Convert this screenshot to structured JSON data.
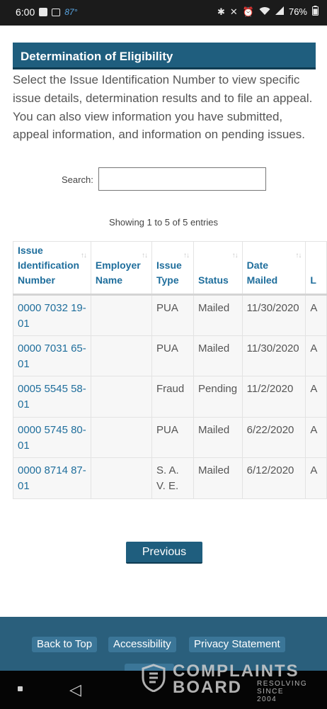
{
  "status_bar": {
    "time": "6:00",
    "temperature": "87°",
    "battery": "76%",
    "icons": [
      "notification-square-icon",
      "gallery-icon",
      "bluetooth-icon",
      "mute-icon",
      "alarm-icon",
      "wifi-icon",
      "signal-icon",
      "battery-icon"
    ]
  },
  "page": {
    "title": "Determination of Eligibility",
    "intro": "Select the Issue Identification Number to view specific issue details, determination results and to file an appeal. You can also view information you have submitted, appeal information, and information on pending issues."
  },
  "search": {
    "label": "Search:",
    "value": "",
    "placeholder": ""
  },
  "table_info": "Showing 1 to 5 of 5 entries",
  "table": {
    "columns": [
      {
        "label": "Issue Identification Number"
      },
      {
        "label": "Employer Name"
      },
      {
        "label": "Issue Type"
      },
      {
        "label": "Status"
      },
      {
        "label": "Date Mailed"
      },
      {
        "label": "L"
      }
    ],
    "rows": [
      {
        "issue_id": "0000 7032 19-01",
        "employer": "",
        "type": "PUA",
        "status": "Mailed",
        "date": "11/30/2020",
        "extra": "A"
      },
      {
        "issue_id": "0000 7031 65-01",
        "employer": "",
        "type": "PUA",
        "status": "Mailed",
        "date": "11/30/2020",
        "extra": "A"
      },
      {
        "issue_id": "0005 5545 58-01",
        "employer": "",
        "type": "Fraud",
        "status": "Pending",
        "date": "11/2/2020",
        "extra": "A"
      },
      {
        "issue_id": "0000 5745 80-01",
        "employer": "",
        "type": "PUA",
        "status": "Mailed",
        "date": "6/22/2020",
        "extra": "A"
      },
      {
        "issue_id": "0000 8714 87-01",
        "employer": "",
        "type": "S. A. V. E.",
        "status": "Mailed",
        "date": "6/12/2020",
        "extra": "A"
      }
    ]
  },
  "pagination": {
    "previous": "Previous"
  },
  "footer": {
    "back_to_top": "Back to Top",
    "accessibility": "Accessibility",
    "privacy": "Privacy Statement"
  },
  "watermark": {
    "line1": "COMPLAINTS",
    "line2": "BOARD",
    "tag1": "RESOLVING",
    "tag2": "SINCE 2004"
  },
  "colors": {
    "header": "#1f5e7e",
    "link": "#1f6e9c",
    "footer": "#2a5f7c"
  }
}
